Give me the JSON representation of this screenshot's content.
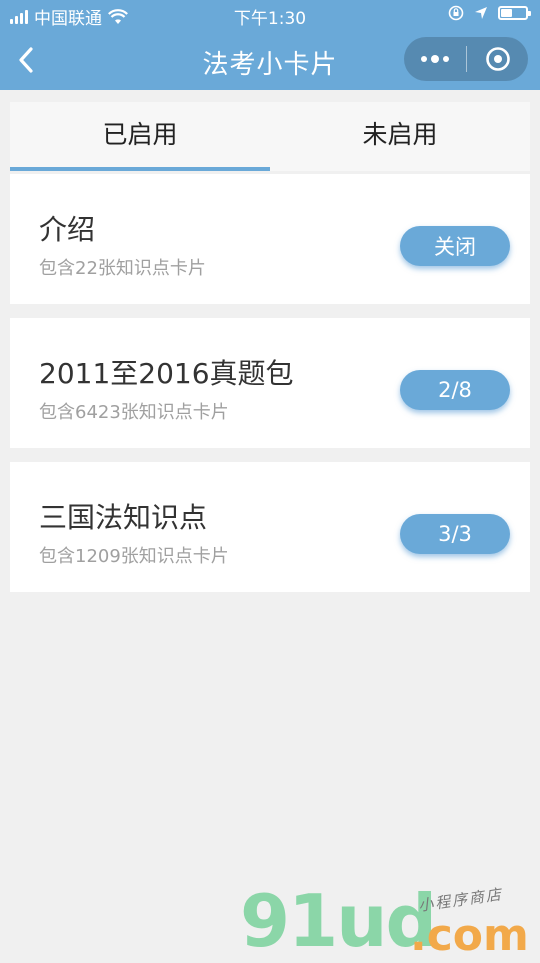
{
  "status_bar": {
    "carrier": "中国联通",
    "time": "下午1:30",
    "battery_level": 0.45
  },
  "nav": {
    "title": "法考小卡片"
  },
  "tabs": [
    {
      "label": "已启用",
      "active": true
    },
    {
      "label": "未启用",
      "active": false
    }
  ],
  "cards": [
    {
      "title": "介绍",
      "subtitle": "包含22张知识点卡片",
      "button": "关闭"
    },
    {
      "title": "2011至2016真题包",
      "subtitle": "包含6423张知识点卡片",
      "button": "2/8"
    },
    {
      "title": "三国法知识点",
      "subtitle": "包含1209张知识点卡片",
      "button": "3/3"
    }
  ],
  "watermark": {
    "main": "91ud",
    "suffix": ".com",
    "tagline": "小程序商店"
  },
  "colors": {
    "accent": "#6aa9d8",
    "background": "#f0f0f0"
  },
  "icons": {
    "back": "back-chevron-icon",
    "more": "more-dots-icon",
    "close": "target-close-icon",
    "wifi": "wifi-icon",
    "location": "location-arrow-icon",
    "lock": "orientation-lock-icon"
  }
}
